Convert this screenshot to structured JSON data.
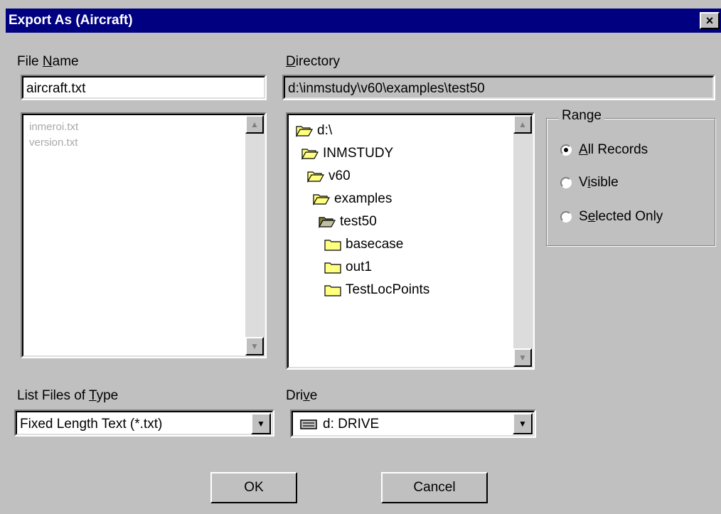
{
  "window": {
    "title": "Export As (Aircraft)",
    "close": "×"
  },
  "file_name": {
    "label_pre": "File ",
    "label_key": "N",
    "label_post": "ame",
    "value": "aircraft.txt"
  },
  "directory": {
    "label_key": "D",
    "label_post": "irectory",
    "path": "d:\\inmstudy\\v60\\examples\\test50"
  },
  "file_list": {
    "items": [
      "inmeroi.txt",
      "version.txt"
    ]
  },
  "folder_tree": {
    "items": [
      {
        "label": "d:\\",
        "icon": "open-folder-icon"
      },
      {
        "label": "INMSTUDY",
        "icon": "open-folder-icon"
      },
      {
        "label": "v60",
        "icon": "open-folder-icon"
      },
      {
        "label": "examples",
        "icon": "open-folder-icon"
      },
      {
        "label": "test50",
        "icon": "open-folder-selected-icon"
      },
      {
        "label": "basecase",
        "icon": "closed-folder-icon"
      },
      {
        "label": "out1",
        "icon": "closed-folder-icon"
      },
      {
        "label": "TestLocPoints",
        "icon": "closed-folder-icon"
      }
    ]
  },
  "range": {
    "title": "Range",
    "options": [
      {
        "key": "A",
        "rest": "ll Records",
        "checked": true
      },
      {
        "pre": "V",
        "key": "i",
        "rest": "sible",
        "checked": false
      },
      {
        "pre": "S",
        "key": "e",
        "rest": "lected Only",
        "checked": false
      }
    ]
  },
  "file_type": {
    "label_pre": "List Files of ",
    "label_key": "T",
    "label_post": "ype",
    "selected": "Fixed Length Text (*.txt)"
  },
  "drive": {
    "label_pre": "Dri",
    "label_key": "v",
    "label_post": "e",
    "selected": "d: DRIVE"
  },
  "buttons": {
    "ok": "OK",
    "cancel": "Cancel"
  },
  "colors": {
    "titlebar": "#000080",
    "face": "#c0c0c0",
    "folder": "#ffff80"
  }
}
